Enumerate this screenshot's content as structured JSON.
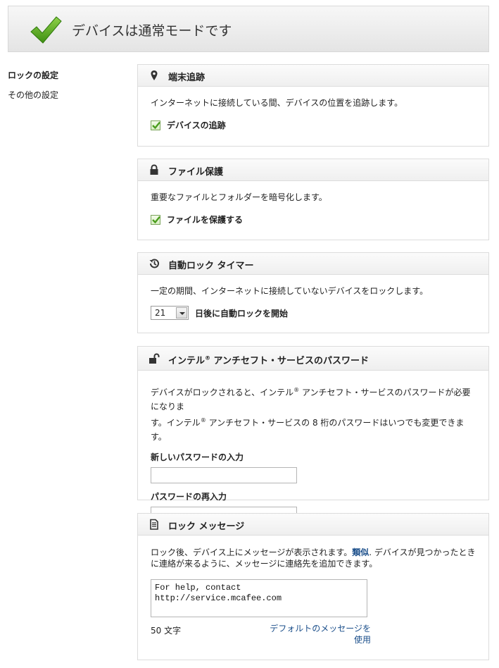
{
  "banner": {
    "title": "デバイスは通常モードです"
  },
  "nav": {
    "items": [
      {
        "label": "ロックの設定"
      },
      {
        "label": "その他の設定"
      }
    ]
  },
  "tracking": {
    "title": "端末追跡",
    "description": "インターネットに接続している間、デバイスの位置を追跡します。",
    "checkbox_label": "デバイスの追跡",
    "checked": true
  },
  "file_protection": {
    "title": "ファイル保護",
    "description": "重要なファイルとフォルダーを暗号化します。",
    "checkbox_label": "ファイルを保護する",
    "checked": true
  },
  "auto_lock": {
    "title": "自動ロック タイマー",
    "description": "一定の期間、インターネットに接続していないデバイスをロックします。",
    "selected_value": "21",
    "suffix_label": "日後に自動ロックを開始"
  },
  "password": {
    "title_pre": "インテル",
    "title_reg": "®",
    "title_post": " アンチセフト・サービスのパスワード",
    "desc_line1_a": "デバイスがロックされると、インテル",
    "desc_line1_reg": "®",
    "desc_line1_b": " アンチセフト・サービスのパスワードが必要になりま",
    "desc_line2_a": "す。インテル",
    "desc_line2_reg": "®",
    "desc_line2_b": " アンチセフト・サービスの 8 桁のパスワードはいつでも変更できます。",
    "new_label": "新しいパスワードの入力",
    "new_value": "",
    "confirm_label": "パスワードの再入力",
    "confirm_value": ""
  },
  "lock_message": {
    "title": "ロック メッセージ",
    "desc_a": "ロック後、デバイス上にメッセージが表示されます。",
    "desc_link": "類似",
    "desc_b": ". デバイスが見つかったときに連絡が来るように、メッセージに連絡先を追加できます。",
    "message": "For help, contact\nhttp://service.mcafee.com",
    "char_count": "50 文字",
    "default_link": "デフォルトのメッセージを使用"
  },
  "colors": {
    "link": "#1a4e8a",
    "check_green": "#4a9d1d",
    "panel_border": "#dcdcdc"
  }
}
